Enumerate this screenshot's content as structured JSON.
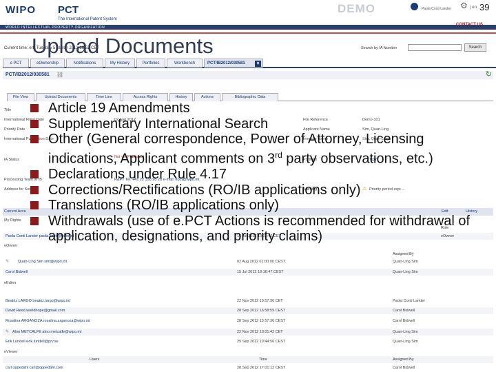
{
  "page_number": "39",
  "header": {
    "wipo": "WIPO",
    "pct": "PCT",
    "pct_sub": "The International Patent System",
    "org": "WORLD INTELLECTUAL PROPERTY ORGANIZATION",
    "demo": "DEMO",
    "contact": "CONTACT US",
    "user": "Paola Conti Lander",
    "lang": "| en"
  },
  "title": "Upload Documents",
  "time_bar": {
    "text": "Current time:               ertt Tuesday  5 March 2013 16:53 CET",
    "search_label": "Search by IA Number",
    "search_button": "Search"
  },
  "nav": [
    "e PCT",
    "eOwnership",
    "Notifications",
    "My History",
    "Portfolios",
    "Workbench",
    "PCT/IB2012/030581"
  ],
  "app_id": "PCT/IB2012/030581",
  "sub_nav": [
    "File View",
    "Upload Documents",
    "Time Line",
    "Access Rights",
    "History",
    "Actions",
    "Bibliographic Data"
  ],
  "details_left": [
    {
      "label": "Title",
      "value": ""
    },
    {
      "label": "International Filing Date",
      "value": "02 Aug 2012"
    },
    {
      "label": "Priority Date",
      "value": ""
    },
    {
      "label": "International Publication Date",
      "value": ""
    },
    {
      "label": "IA Status",
      "value": ""
    },
    {
      "label": "",
      "value": "Not yet Published"
    },
    {
      "label": "Processing Team at IB",
      "value": "R&PT  Tel. +41 22 338 95 28   e-mail: epct@wipo.int"
    },
    {
      "label": "Address for Service",
      "value": ""
    }
  ],
  "details_right": [
    {
      "label": "File Reference",
      "value": "Demo-101"
    },
    {
      "label": "Applicant Name",
      "value": "Sim, Quan-Ling"
    },
    {
      "label": "Inventor Name",
      "value": "Sim, Quan-Ling"
    },
    {
      "label": "Portfolio",
      "value": "TQY"
    },
    {
      "label": "Warning",
      "value": "Priority period expi ..."
    }
  ],
  "rights": {
    "current_access": "Current Acce",
    "edit": "Edit",
    "history": "History",
    "my_rights": "My Rights",
    "role_header": "Role",
    "owner_row": {
      "user": "Paola Conti Lander paola.conti@wipo.int",
      "date": "16 Jul 2012 10:01:42 CET",
      "role": "eOwner"
    },
    "eowner_label": "eOwner",
    "assigned_by_header": "Assigned By",
    "eowner_rows": [
      {
        "user": "Quan-Ling Sim  sim@wipo.int",
        "date": "02 Aug 2012 01:00:00 CEST",
        "by": "Quan-Ling Sim"
      },
      {
        "user": "Carol Bidwell",
        "date": "15 Jul 2012 18:16:47 CEST",
        "by": "Quan-Ling Sim"
      }
    ],
    "editor_label": "eEditor",
    "editor_rows": [
      {
        "user": "Beatriz LARGO  beatriz.largo@wipo.int",
        "date": "22 Nov 2012 10:57:36 CET",
        "by": "Paola Conti Lander"
      },
      {
        "user": "David Reed  worldhope@gmail.com",
        "date": "28 Sep 2012 16:58:59 CEST",
        "by": "Carol Bidwell"
      },
      {
        "user": "Rosalina ARGANOZA  rosalina.arganoza@wipo.int",
        "date": "28 Sep 2012 15:57:36 CEST",
        "by": "Carol Bidwell"
      },
      {
        "user": "Alno METCALFE  alno.metcalfe@wipo.int",
        "date": "22 Nov 2012 10:01:42 CET",
        "by": "Quan-Ling Sim"
      },
      {
        "user": "Erik Lundell  erik.lundell@prv.se",
        "date": "29 Sep 2012 10:44:56 CEST",
        "by": "Quan-Ling Sim"
      }
    ],
    "viewer_label": "eViewer",
    "viewer_headers": {
      "users": "Users",
      "time": "Time",
      "by": "Assigned By"
    },
    "viewer_rows": [
      {
        "user": "carl oppedahl  carl@oppedahl.com",
        "date": "28 Sep 2012 17:01:12 CEST",
        "by": "Carol Bidwell"
      }
    ]
  },
  "bullets": [
    {
      "text": "Article 19 Amendments"
    },
    {
      "text": "Supplementary International Search"
    },
    {
      "text": "Other (General correspondence, Power of Attorney, Licensing indications, Applicant comments on 3",
      "sup": "rd",
      "tail": " party observations, etc.)"
    },
    {
      "text": "Declarations under Rule 4.17"
    },
    {
      "text": "Corrections/Rectifications (RO/IB applications only)"
    },
    {
      "text": "Translations (RO/IB applications only)"
    },
    {
      "text": "Withdrawals (use of e.PCT Actions is recommended for withdrawal of application, designations, and priority claims)"
    }
  ],
  "colors": {
    "brand": "#1a3a78",
    "bullet": "#8b1a1a",
    "band": "#2a3f6e"
  }
}
